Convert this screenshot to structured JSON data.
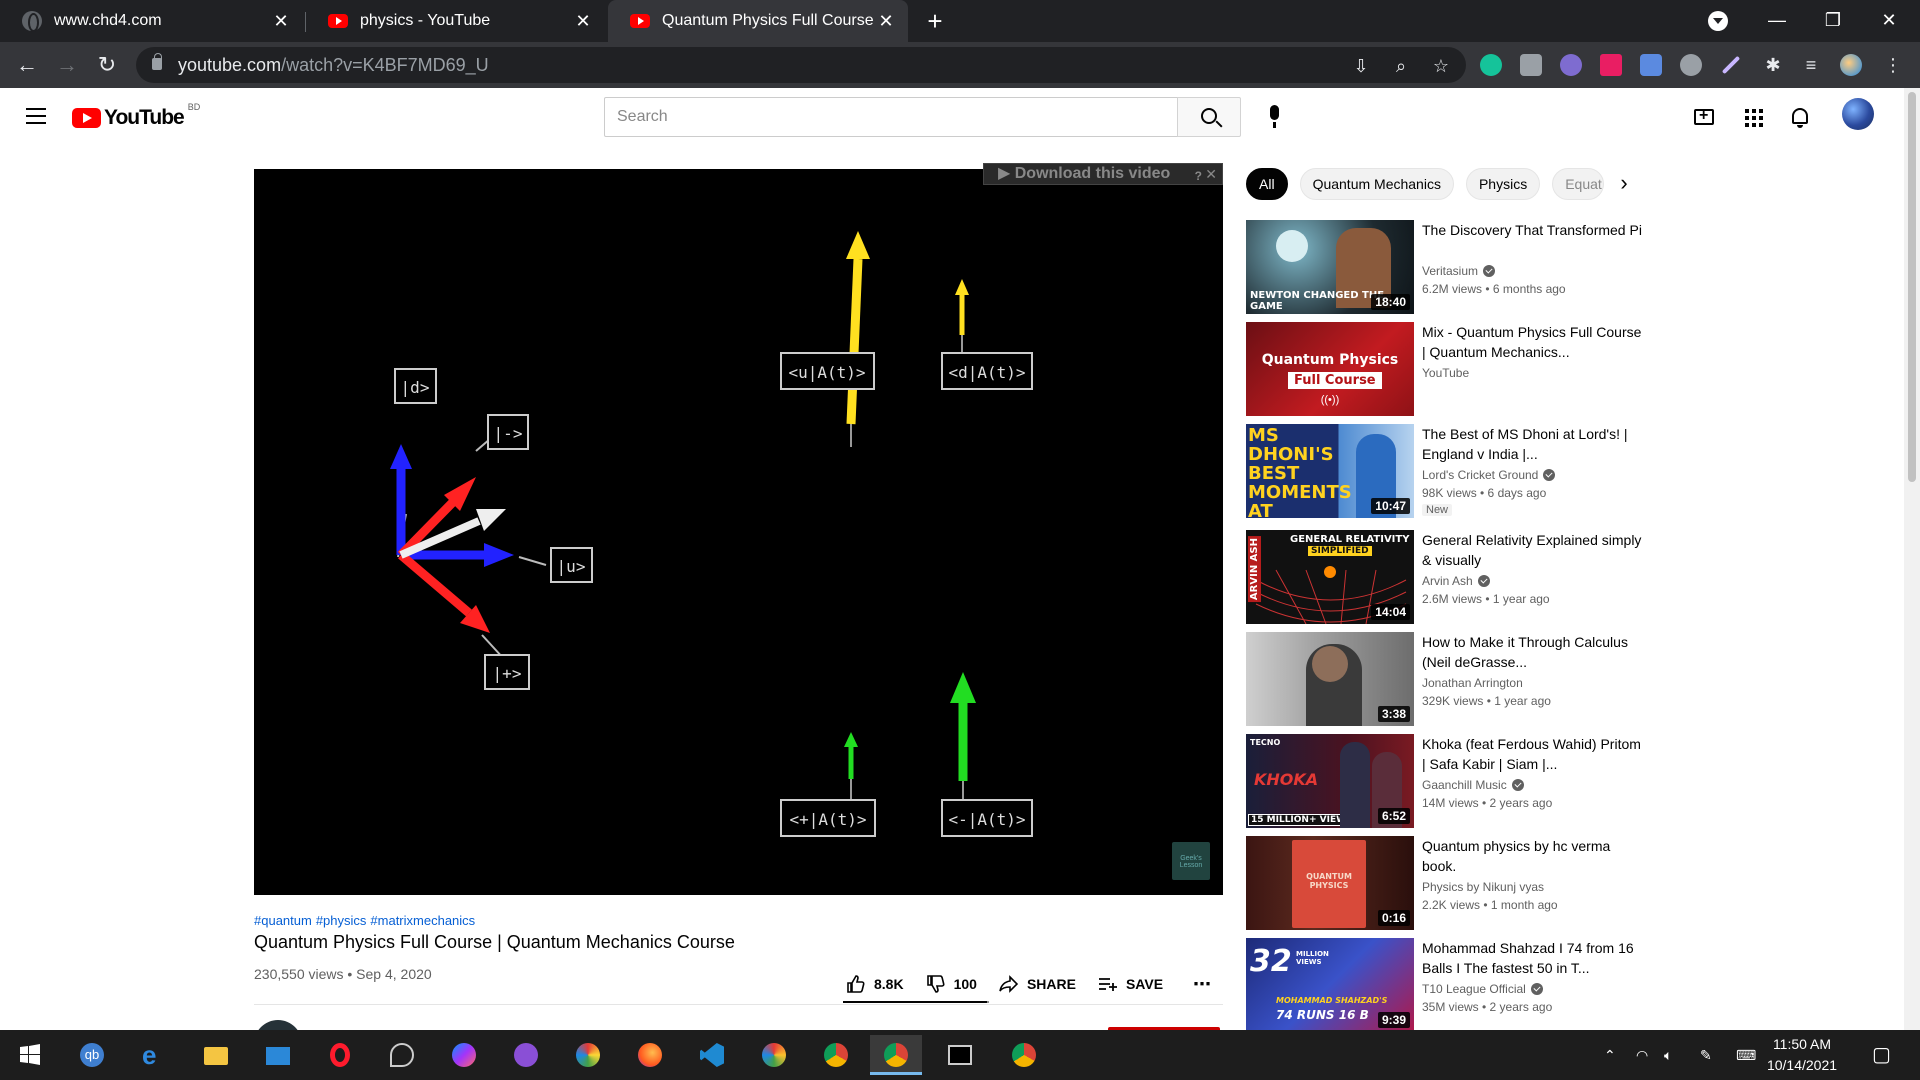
{
  "browser": {
    "tabs": [
      {
        "title": "www.chd4.com",
        "favicon": "globe-icon",
        "active": false
      },
      {
        "title": "physics - YouTube",
        "favicon": "youtube-icon",
        "active": false
      },
      {
        "title": "Quantum Physics Full Course | Qu",
        "favicon": "youtube-icon",
        "active": true
      }
    ],
    "url_host": "youtube.com",
    "url_path": "/watch?v=K4BF7MD69_U"
  },
  "youtube": {
    "region": "BD",
    "search_placeholder": "Search",
    "chips": [
      "All",
      "Quantum Mechanics",
      "Physics",
      "Equat"
    ]
  },
  "video": {
    "download_bar": "Download this video",
    "download_help": "?",
    "download_close": "✕",
    "hashtags": [
      "#quantum",
      "#physics",
      "#matrixmechanics"
    ],
    "title": "Quantum Physics Full Course | Quantum Mechanics Course",
    "meta": "230,550 views • Sep 4, 2020",
    "likes": "8.8K",
    "dislikes": "100",
    "share_label": "SHARE",
    "save_label": "SAVE",
    "more_label": "⋯",
    "like_ratio": 0.989,
    "frame_labels": {
      "d": "|d>",
      "minus": "|->",
      "u": "|u>",
      "plus": "|+>",
      "uA": "<u|A(t)>",
      "dA": "<d|A(t)>",
      "pA": "<+|A(t)>",
      "mA": "<-|A(t)>"
    },
    "watermark": "Geek's Lesson"
  },
  "recommendations": [
    {
      "title": "The Discovery That Transformed Pi",
      "channel": "Veritasium",
      "verified": true,
      "meta": "6.2M views • 6 months ago",
      "duration": "18:40",
      "thumb_text": "NEWTON CHANGED THE GAME"
    },
    {
      "title": "Mix - Quantum Physics Full Course | Quantum Mechanics...",
      "channel": "YouTube",
      "verified": false,
      "meta": "",
      "duration": "",
      "thumb_text": "Quantum Physics",
      "thumb_text2": "Full Course",
      "thumb_live": "((•))"
    },
    {
      "title": "The Best of MS Dhoni at Lord's! | England v India |...",
      "channel": "Lord's Cricket Ground",
      "verified": true,
      "meta": "98K views • 6 days ago",
      "badge": "New",
      "duration": "10:47",
      "thumb_text": "MS DHONI'S BEST MOMENTS AT LORD'S"
    },
    {
      "title": "General Relativity Explained simply & visually",
      "channel": "Arvin Ash",
      "verified": true,
      "meta": "2.6M views • 1 year ago",
      "duration": "14:04",
      "thumb_text": "GENERAL RELATIVITY",
      "thumb_text2": "SIMPLIFIED",
      "thumb_side": "ARVIN ASH"
    },
    {
      "title": "How to Make it Through Calculus (Neil deGrasse...",
      "channel": "Jonathan Arrington",
      "verified": false,
      "meta": "329K views • 1 year ago",
      "duration": "3:38"
    },
    {
      "title": "Khoka (feat Ferdous Wahid) Pritom | Safa Kabir | Siam |...",
      "channel": "Gaanchill Music",
      "verified": true,
      "meta": "14M views • 2 years ago",
      "duration": "6:52",
      "thumb_text": "KHOKA",
      "thumb_text2": "15 MILLION+ VIEWS",
      "thumb_brand": "TECNO"
    },
    {
      "title": "Quantum physics by hc verma book.",
      "channel": "Physics by Nikunj vyas",
      "verified": false,
      "meta": "2.2K views • 1 month ago",
      "duration": "0:16",
      "thumb_text": "QUANTUM PHYSICS"
    },
    {
      "title": "Mohammad Shahzad I 74 from 16 Balls I The fastest 50 in T...",
      "channel": "T10 League Official",
      "verified": true,
      "meta": "35M views • 2 years ago",
      "duration": "9:39",
      "thumb_text": "32",
      "thumb_text2": "MILLION VIEWS",
      "thumb_text3": "MOHAMMAD SHAHZAD'S",
      "thumb_text4": "74 RUNS 16 B"
    }
  ],
  "taskbar": {
    "time": "11:50 AM",
    "date": "10/14/2021",
    "apps": [
      "windows-start",
      "qbittorrent",
      "edge",
      "file-explorer",
      "mail",
      "opera",
      "satellite-app",
      "messenger",
      "github-desktop",
      "paint-app",
      "firefox",
      "vscode",
      "chromium-app",
      "chrome",
      "chrome-active",
      "terminal",
      "chrome-profile"
    ]
  },
  "colors": {
    "youtube_red": "#ff0000",
    "link_blue": "#065fd4",
    "chrome_dark": "#202124"
  }
}
